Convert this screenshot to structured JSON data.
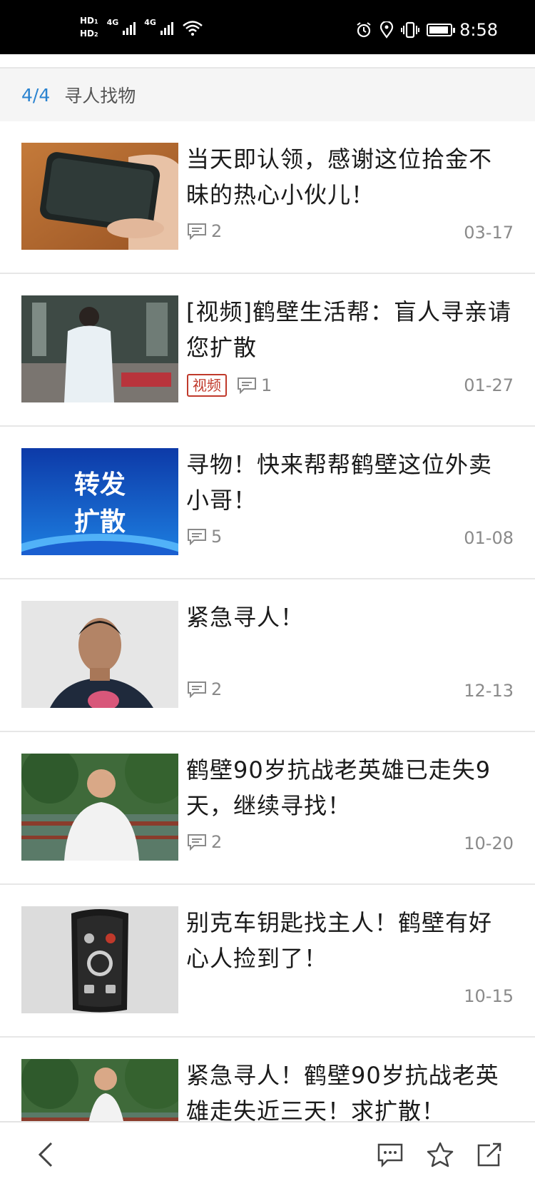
{
  "status_bar": {
    "time": "8:58",
    "sim1": "HD",
    "sim1_num": "1",
    "sim2": "HD",
    "sim2_num": "2",
    "network1": "4G",
    "network2": "4G",
    "icons": [
      "alarm-icon",
      "location-icon",
      "vibrate-icon",
      "battery-icon"
    ]
  },
  "header": {
    "page_indicator": "4/4",
    "title": "寻人找物",
    "accent_color": "#2a83d0"
  },
  "news": [
    {
      "title": "当天即认领，感谢这位拾金不昧的热心小伙儿！",
      "comments": "2",
      "date": "03-17",
      "video": false,
      "thumb": "phone-in-hand"
    },
    {
      "title": "[视频]鹤壁生活帮：盲人寻亲请您扩散",
      "comments": "1",
      "date": "01-27",
      "video": true,
      "tag": "视频",
      "thumb": "man-in-white-coat"
    },
    {
      "title": "寻物！快来帮帮鹤壁这位外卖小哥！",
      "comments": "5",
      "date": "01-08",
      "video": false,
      "thumb": "share-banner",
      "thumb_text_1": "转发",
      "thumb_text_2": "扩散"
    },
    {
      "title": "紧急寻人！",
      "comments": "2",
      "date": "12-13",
      "video": false,
      "thumb": "man-portrait"
    },
    {
      "title": "鹤壁90岁抗战老英雄已走失9天，继续寻找！",
      "comments": "2",
      "date": "10-20",
      "video": false,
      "thumb": "elderly-man-park"
    },
    {
      "title": "别克车钥匙找主人！鹤壁有好心人捡到了！",
      "comments": "",
      "date": "10-15",
      "video": false,
      "thumb": "car-key"
    },
    {
      "title": "紧急寻人！鹤壁90岁抗战老英雄走失近三天！求扩散！",
      "comments": "",
      "date": "",
      "video": false,
      "thumb": "elderly-man-park"
    }
  ],
  "bottom_bar": {
    "icons": [
      "back-icon",
      "comment-icon",
      "star-icon",
      "share-icon"
    ]
  }
}
